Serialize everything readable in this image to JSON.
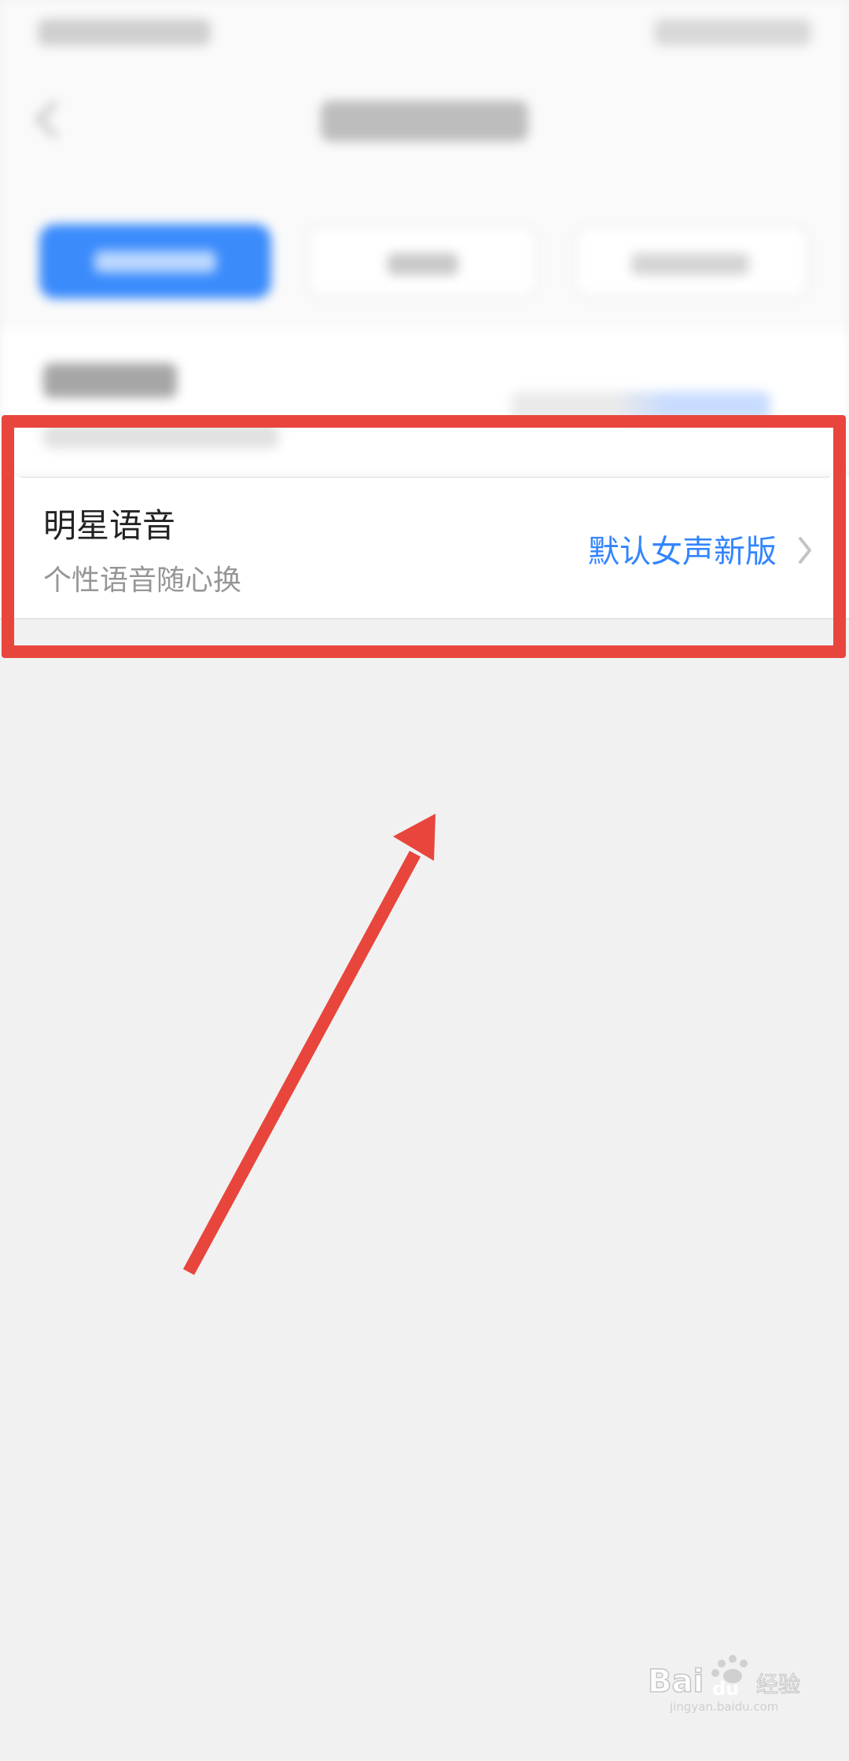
{
  "setting_row": {
    "title": "明星语音",
    "subtitle": "个性语音随心换",
    "value": "默认女声新版"
  },
  "watermark": {
    "brand": "Baidu经验",
    "domain": "jingyan.baidu.com"
  },
  "colors": {
    "accent": "#3385ff",
    "annotation": "#e8453c",
    "page_background": "#f1f1f1"
  },
  "icons": {
    "row_chevron": "chevron-right-icon",
    "back": "back-arrow-icon"
  }
}
